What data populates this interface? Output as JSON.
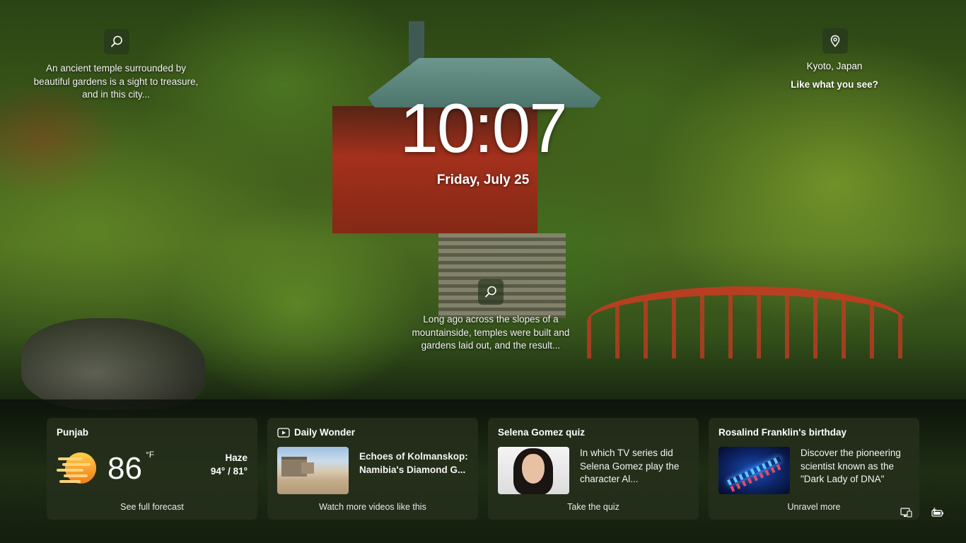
{
  "lock_screen": {
    "time": "10:07",
    "date": "Friday, July 25"
  },
  "spotlight": {
    "caption_top": "An ancient temple surrounded by beautiful gardens is a sight to treasure, and in this city...",
    "caption_middle": "Long ago across the slopes of a mountainside, temples were built and gardens laid out, and the result...",
    "location": "Kyoto, Japan",
    "like_prompt": "Like what you see?"
  },
  "widgets": {
    "weather": {
      "location": "Punjab",
      "temperature": "86",
      "unit": "°F",
      "condition": "Haze",
      "range": "94° / 81°",
      "footer": "See full forecast",
      "icon": "haze-sun-icon"
    },
    "daily_wonder": {
      "title": "Daily Wonder",
      "headline": "Echoes of Kolmanskop: Namibia's Diamond G...",
      "footer": "Watch more videos like this",
      "icon": "video-icon"
    },
    "quiz": {
      "title": "Selena Gomez quiz",
      "text": "In which TV series did Selena Gomez play the character Al...",
      "footer": "Take the quiz"
    },
    "birthday": {
      "title": "Rosalind Franklin's birthday",
      "text": "Discover the pioneering scientist known as the \"Dark Lady of DNA\"",
      "footer": "Unravel more"
    }
  },
  "tray": {
    "network_icon": "network-icon",
    "battery_icon": "battery-charging-icon"
  },
  "colors": {
    "card_bg": "#26301c",
    "weather_sun": "#f5a623"
  }
}
